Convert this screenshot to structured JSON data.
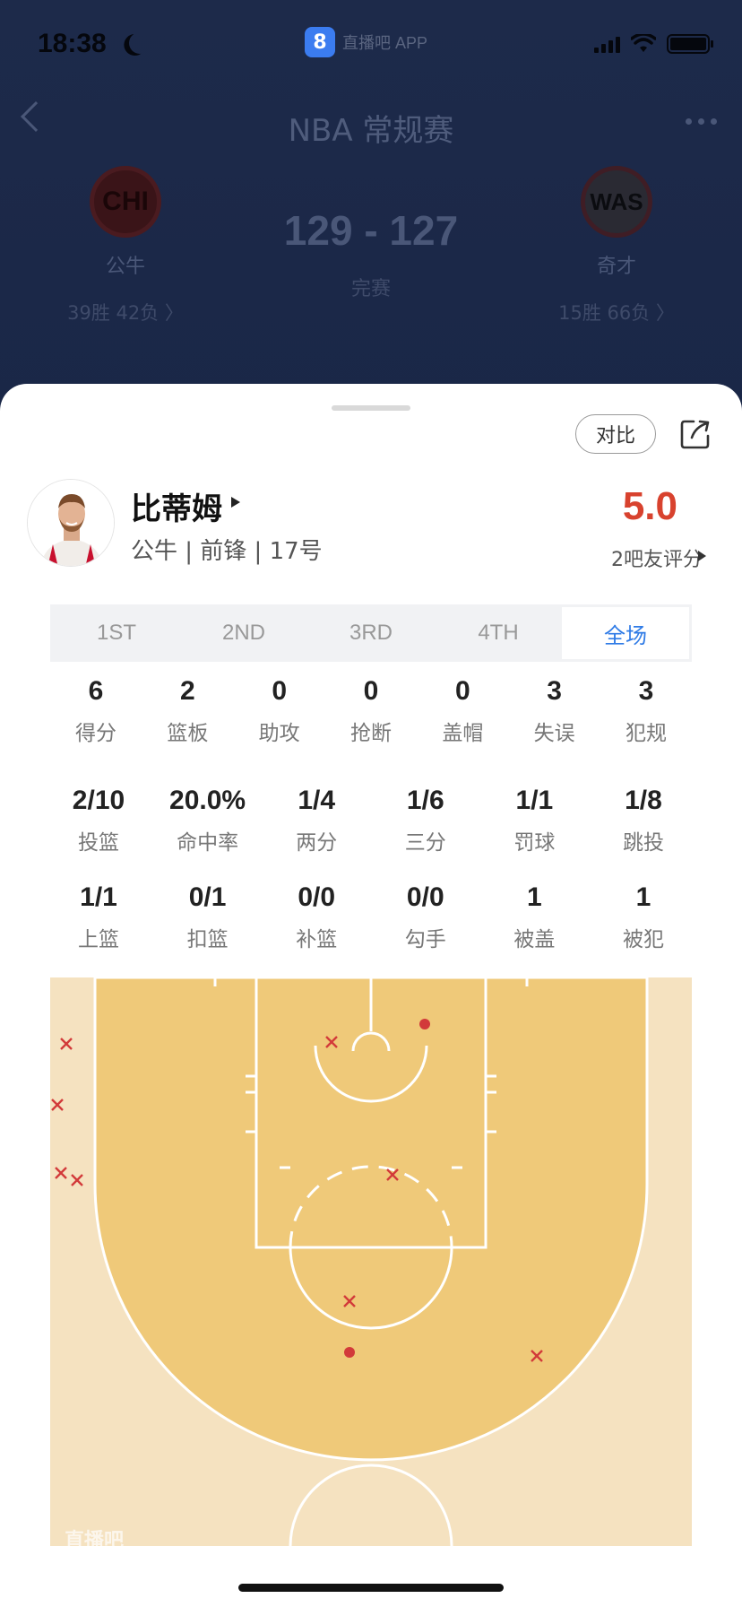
{
  "status_bar": {
    "time": "18:38",
    "app_badge": "直播吧 APP",
    "app_logo": "8"
  },
  "nav": {
    "title": "NBA 常规赛"
  },
  "game": {
    "home": {
      "abbr": "CHI",
      "name": "公牛",
      "record": "39胜 42负 〉",
      "color": "#7a1f2a"
    },
    "away": {
      "abbr": "WAS",
      "name": "奇才",
      "record": "15胜 66负 〉",
      "color": "#2a2a33"
    },
    "score": "129 - 127",
    "status": "完赛"
  },
  "actions": {
    "compare_label": "对比",
    "share_icon": "share-icon"
  },
  "player": {
    "name": "比蒂姆",
    "meta": "公牛 | 前锋 | 17号",
    "rating": "5.0",
    "rating_count": "2吧友评分"
  },
  "tabs": [
    {
      "label": "1ST",
      "active": false
    },
    {
      "label": "2ND",
      "active": false
    },
    {
      "label": "3RD",
      "active": false
    },
    {
      "label": "4TH",
      "active": false
    },
    {
      "label": "全场",
      "active": true
    }
  ],
  "stats_row1": [
    {
      "value": "6",
      "label": "得分"
    },
    {
      "value": "2",
      "label": "篮板"
    },
    {
      "value": "0",
      "label": "助攻"
    },
    {
      "value": "0",
      "label": "抢断"
    },
    {
      "value": "0",
      "label": "盖帽"
    },
    {
      "value": "3",
      "label": "失误"
    },
    {
      "value": "3",
      "label": "犯规"
    }
  ],
  "stats_row2": [
    {
      "value": "2/10",
      "label": "投篮"
    },
    {
      "value": "20.0%",
      "label": "命中率"
    },
    {
      "value": "1/4",
      "label": "两分"
    },
    {
      "value": "1/6",
      "label": "三分"
    },
    {
      "value": "1/1",
      "label": "罚球"
    },
    {
      "value": "1/8",
      "label": "跳投"
    }
  ],
  "stats_row3": [
    {
      "value": "1/1",
      "label": "上篮"
    },
    {
      "value": "0/1",
      "label": "扣篮"
    },
    {
      "value": "0/0",
      "label": "补篮"
    },
    {
      "value": "0/0",
      "label": "勾手"
    },
    {
      "value": "1",
      "label": "被盖"
    },
    {
      "value": "1",
      "label": "被犯"
    }
  ],
  "shot_chart": {
    "made_color": "#d23a3a",
    "miss_color": "#d23a3a",
    "watermark": "直播吧"
  }
}
